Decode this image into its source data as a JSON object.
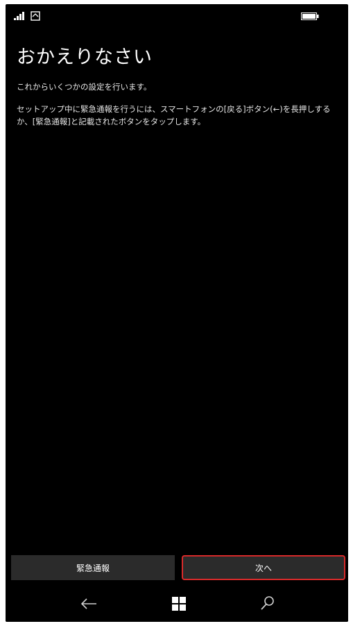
{
  "header": {
    "title": "おかえりなさい"
  },
  "body": {
    "intro": "これからいくつかの設定を行います。",
    "emergency_info": "セットアップ中に緊急通報を行うには、スマートフォンの[戻る]ボタン(←)を長押しするか、[緊急通報]と記載されたボタンをタップします。"
  },
  "buttons": {
    "emergency_label": "緊急通報",
    "next_label": "次へ"
  },
  "icons": {
    "status": [
      "signal-icon",
      "wifi-icon",
      "battery-icon"
    ],
    "nav": [
      "back-arrow-icon",
      "windows-start-icon",
      "search-icon"
    ]
  },
  "colors": {
    "background": "#000000",
    "button": "#2b2b2b",
    "highlight": "#d92a2a",
    "text": "#ffffff"
  }
}
